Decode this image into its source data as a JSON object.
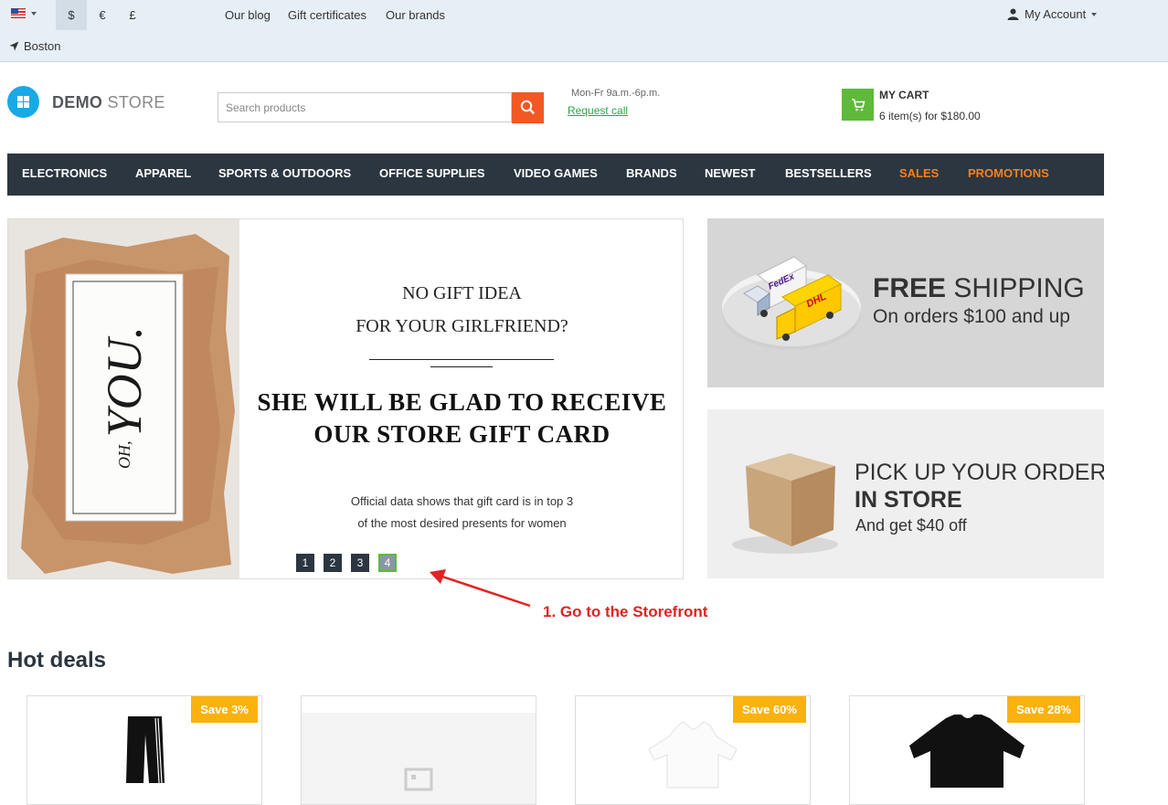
{
  "topbar": {
    "currencies": [
      "$",
      "€",
      "£"
    ],
    "links": [
      "Our blog",
      "Gift certificates",
      "Our brands"
    ],
    "account_label": "My Account",
    "location": "Boston"
  },
  "header": {
    "logo_bold": "DEMO",
    "logo_light": "STORE",
    "search_placeholder": "Search products",
    "hours": "Mon-Fr 9a.m.-6p.m.",
    "request_call": "Request call",
    "cart_title": "MY CART",
    "cart_summary": "6 item(s) for $180.00"
  },
  "nav": {
    "items": [
      {
        "label": "ELECTRONICS"
      },
      {
        "label": "APPAREL"
      },
      {
        "label": "SPORTS & OUTDOORS"
      },
      {
        "label": "OFFICE SUPPLIES"
      },
      {
        "label": "VIDEO GAMES"
      },
      {
        "label": "BRANDS"
      },
      {
        "label": "NEWEST"
      },
      {
        "label": "BESTSELLERS"
      },
      {
        "label": "SALES",
        "color": "#f97f1c"
      },
      {
        "label": "PROMOTIONS",
        "color": "#f97f1c"
      }
    ]
  },
  "slider": {
    "line1": "NO GIFT IDEA",
    "line2": "FOR YOUR GIRLFRIEND?",
    "headline1": "SHE WILL BE GLAD TO RECEIVE",
    "headline2": "OUR STORE GIFT CARD",
    "small1": "Official data shows that gift card is in top 3",
    "small2": "of the most desired presents for women",
    "card_small": "OH,",
    "card_big": "YOU.",
    "pages": [
      "1",
      "2",
      "3",
      "4"
    ],
    "active_page": "4"
  },
  "promos": {
    "shipping_bold": "FREE",
    "shipping_rest": "SHIPPING",
    "shipping_sub": "On orders $100 and up",
    "truck1_brand": "FedEx",
    "truck2_brand": "DHL",
    "pickup_line1": "PICK UP YOUR ORDER",
    "pickup_line2": "IN STORE",
    "pickup_sub": "And get $40 off"
  },
  "annotation": "1. Go to the Storefront",
  "hot_deals": {
    "title": "Hot deals",
    "cards": [
      {
        "badge": "Save 3%"
      },
      {
        "badge": ""
      },
      {
        "badge": "Save 60%"
      },
      {
        "badge": "Save 28%"
      }
    ]
  },
  "colors": {
    "nav_bg": "#2b3640",
    "accent_orange": "#f25822",
    "nav_highlight": "#f97f1c",
    "cart_green": "#5fb93a",
    "badge_yellow": "#fbb20f",
    "annotation_red": "#e32222"
  },
  "icons": {
    "flag": "us-flag-icon",
    "account": "user-icon",
    "location": "location-arrow-icon",
    "search": "search-icon",
    "cart": "cart-icon"
  }
}
